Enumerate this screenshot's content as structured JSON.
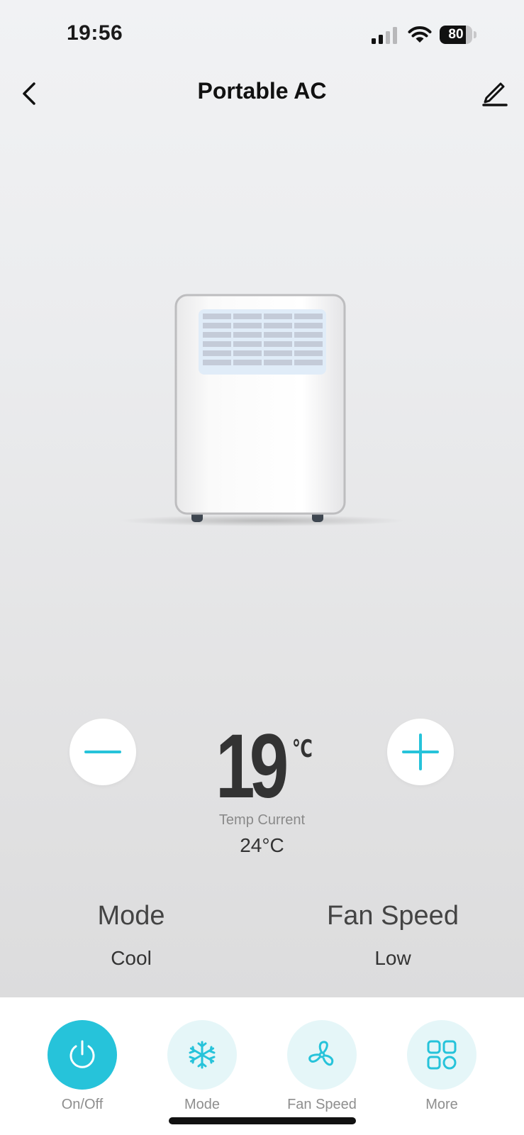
{
  "status_bar": {
    "time": "19:56",
    "battery": "80",
    "battery_level": 0.8,
    "icons": [
      "signal-icon",
      "wifi-icon",
      "battery-icon"
    ]
  },
  "header": {
    "title": "Portable AC",
    "back_icon": "chevron-left-icon",
    "edit_icon": "pencil-icon"
  },
  "device": {
    "image": "portable-ac-illustration"
  },
  "temperature": {
    "set_value": "19",
    "unit": "℃",
    "current_label": "Temp Current",
    "current_value": "24°C",
    "decrease_icon": "minus-icon",
    "increase_icon": "plus-icon"
  },
  "info": {
    "mode_title": "Mode",
    "mode_value": "Cool",
    "fan_title": "Fan Speed",
    "fan_value": "Low"
  },
  "actions": [
    {
      "label": "On/Off",
      "icon": "power-icon",
      "active": true
    },
    {
      "label": "Mode",
      "icon": "snowflake-icon",
      "active": false
    },
    {
      "label": "Fan Speed",
      "icon": "fan-icon",
      "active": false
    },
    {
      "label": "More",
      "icon": "grid-icon",
      "active": false
    }
  ],
  "colors": {
    "accent": "#26c3da",
    "accent_light": "#e5f6f8",
    "text_primary": "#111111",
    "text_secondary": "#8a8a8a"
  }
}
